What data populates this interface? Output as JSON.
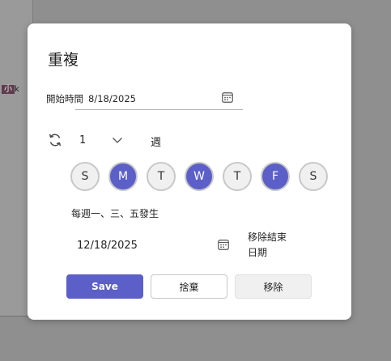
{
  "background": {
    "snippet_highlight": "小",
    "snippet_rest": "k"
  },
  "dialog": {
    "title": "重複",
    "start": {
      "label": "開始時間",
      "value": "8/18/2025",
      "picker_icon": "calendar-icon"
    },
    "recurrence": {
      "icon": "repeat-icon",
      "interval": "1",
      "dropdown_icon": "chevron-down-icon",
      "frequency": "週"
    },
    "days": [
      {
        "label": "S",
        "selected": false
      },
      {
        "label": "M",
        "selected": true
      },
      {
        "label": "T",
        "selected": false
      },
      {
        "label": "W",
        "selected": true
      },
      {
        "label": "T",
        "selected": false
      },
      {
        "label": "F",
        "selected": true
      },
      {
        "label": "S",
        "selected": false
      }
    ],
    "summary": "每週一、三、五發生",
    "end": {
      "value": "12/18/2025",
      "picker_icon": "calendar-icon",
      "remove_label": "移除結束日期"
    },
    "buttons": {
      "save": "Save",
      "discard": "捨棄",
      "remove": "移除"
    }
  },
  "colors": {
    "accent": "#5b5fc7",
    "overlay": "#8f8f8f",
    "day_off_bg": "#f0f0f0"
  }
}
